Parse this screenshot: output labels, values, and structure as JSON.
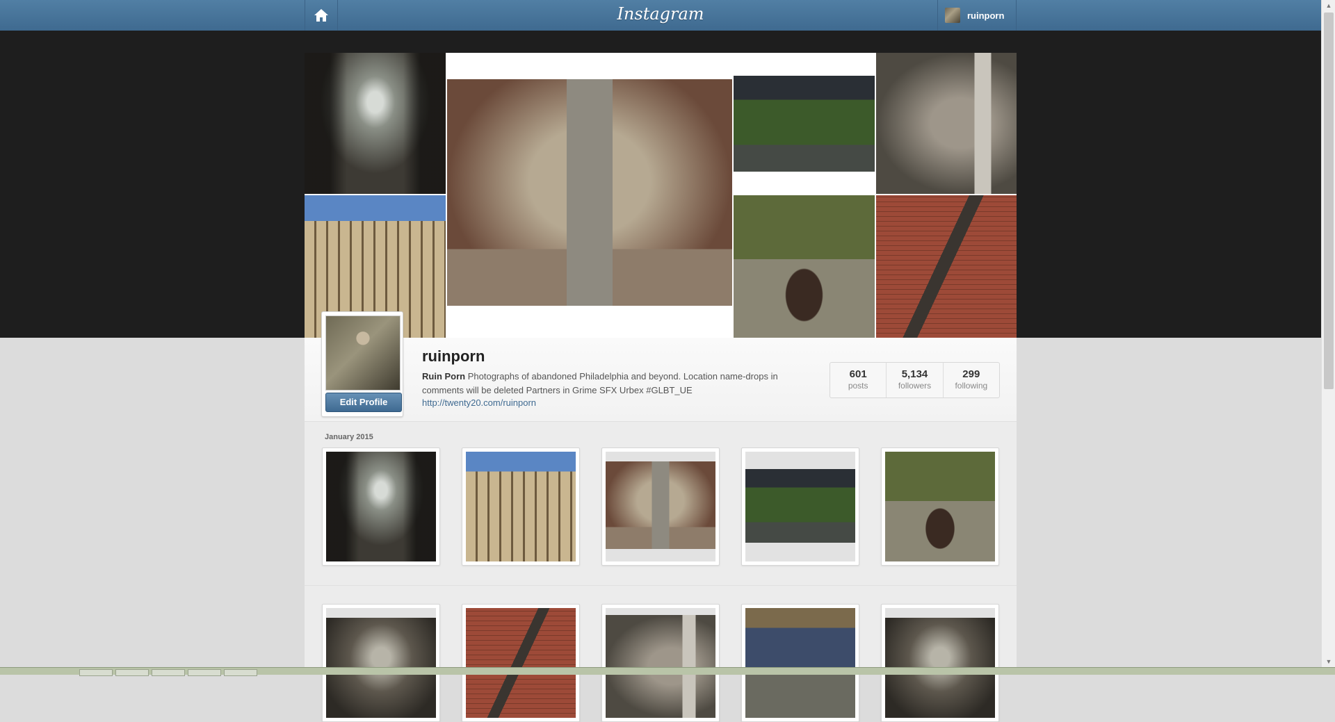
{
  "app": {
    "logo": "Instagram",
    "username": "ruinporn"
  },
  "profile": {
    "username": "ruinporn",
    "full_name": "Ruin Porn",
    "bio": "Photographs of abandoned Philadelphia and beyond. Location name-drops in comments will be deleted  Partners in Grime  SFX Urbex  #GLBT_UE",
    "link": "http://twenty20.com/ruinporn",
    "edit_label": "Edit Profile"
  },
  "stats": [
    {
      "value": "601",
      "label": "posts"
    },
    {
      "value": "5,134",
      "label": "followers"
    },
    {
      "value": "299",
      "label": "following"
    }
  ],
  "feed": {
    "month": "January 2015"
  },
  "icons": {
    "home": "home-icon",
    "scroll_up": "arrow-up-icon",
    "scroll_down": "arrow-down-icon"
  },
  "colors": {
    "nav_blue": "#3f6a90",
    "link_blue": "#3f6a91",
    "hero_dark": "#1e1e1e"
  }
}
